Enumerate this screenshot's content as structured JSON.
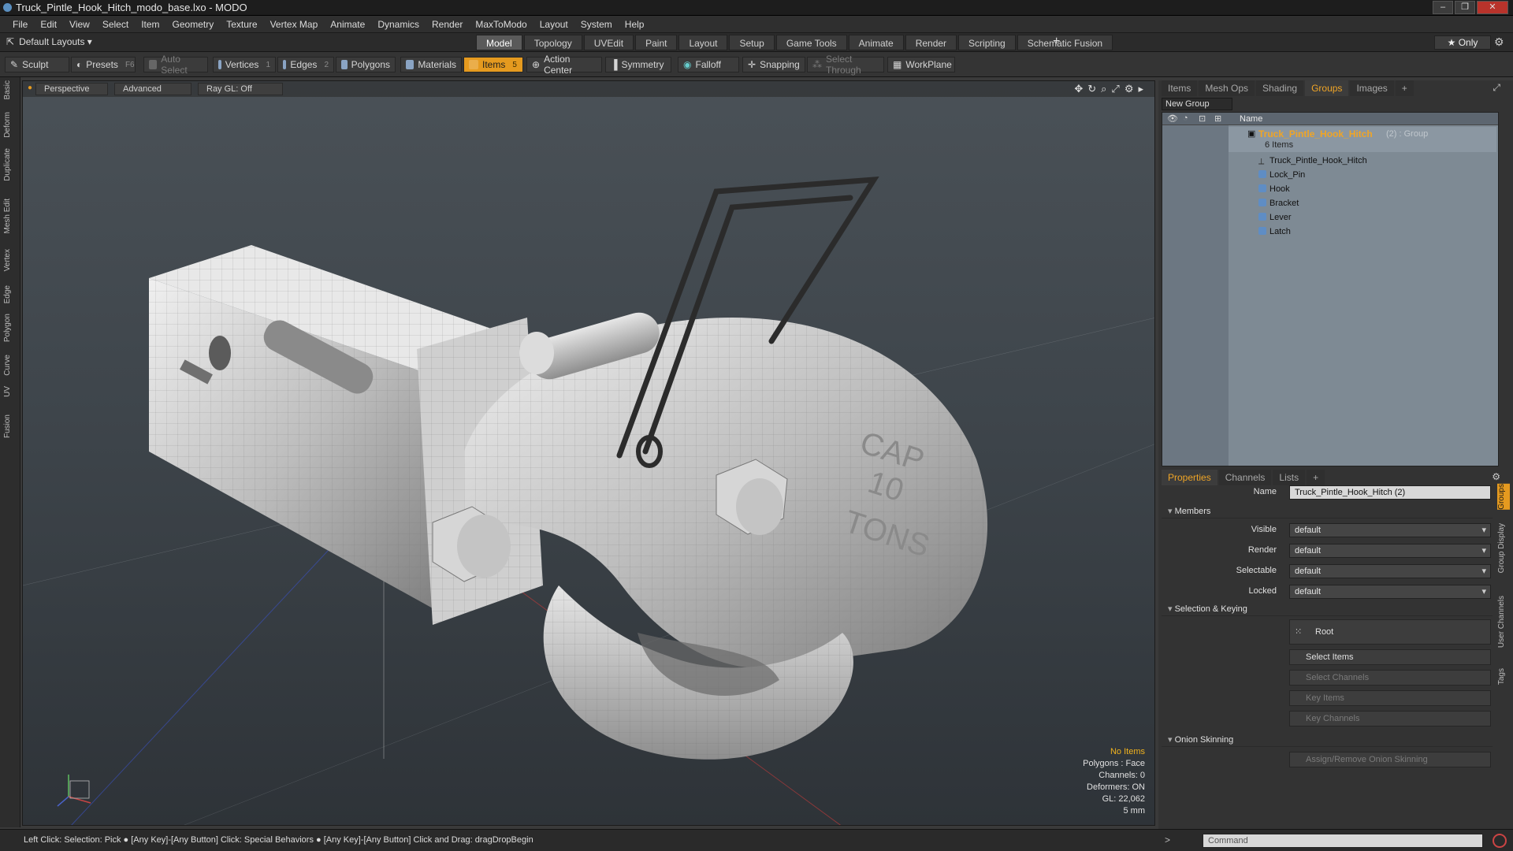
{
  "window": {
    "title": "Truck_Pintle_Hook_Hitch_modo_base.lxo - MODO"
  },
  "menu": [
    "File",
    "Edit",
    "View",
    "Select",
    "Item",
    "Geometry",
    "Texture",
    "Vertex Map",
    "Animate",
    "Dynamics",
    "Render",
    "MaxToModo",
    "Layout",
    "System",
    "Help"
  ],
  "layout_selector": "Default Layouts ▾",
  "layout_tabs": [
    {
      "label": "Model",
      "active": true
    },
    {
      "label": "Topology"
    },
    {
      "label": "UVEdit"
    },
    {
      "label": "Paint"
    },
    {
      "label": "Layout"
    },
    {
      "label": "Setup"
    },
    {
      "label": "Game Tools"
    },
    {
      "label": "Animate"
    },
    {
      "label": "Render"
    },
    {
      "label": "Scripting"
    },
    {
      "label": "Schematic Fusion"
    }
  ],
  "only_button": "★ Only",
  "toolbar": {
    "sculpt": "Sculpt",
    "presets": "Presets",
    "presets_key": "F6",
    "auto_select": "Auto Select",
    "vertices": "Vertices",
    "vertices_key": "1",
    "edges": "Edges",
    "edges_key": "2",
    "polygons": "Polygons",
    "materials": "Materials",
    "items": "Items",
    "items_key": "5",
    "action_center": "Action Center",
    "symmetry": "Symmetry",
    "falloff": "Falloff",
    "snapping": "Snapping",
    "select_through": "Select Through",
    "workplane": "WorkPlane"
  },
  "left_tabs": [
    "Basic",
    "Deform",
    "Duplicate",
    "Mesh Edit",
    "Vertex",
    "Edge",
    "Polygon",
    "Curve",
    "UV",
    "Fusion"
  ],
  "viewport": {
    "perspective": "Perspective",
    "advanced": "Advanced",
    "raygl": "Ray GL: Off",
    "hook_text": [
      "CAP",
      "10",
      "TONS"
    ],
    "info": {
      "no_items": "No Items",
      "polygons": "Polygons : Face",
      "channels": "Channels: 0",
      "deformers": "Deformers: ON",
      "gl": "GL: 22,062",
      "scale": "5 mm"
    }
  },
  "status_text": "Left Click: Selection: Pick ● [Any Key]-[Any Button] Click: Special Behaviors ● [Any Key]-[Any Button] Click and Drag: dragDropBegin",
  "top_panel_tabs": [
    {
      "label": "Items"
    },
    {
      "label": "Mesh Ops"
    },
    {
      "label": "Shading"
    },
    {
      "label": "Groups",
      "active": true
    },
    {
      "label": "Images"
    },
    {
      "label": "+"
    }
  ],
  "new_group": "New Group",
  "tree": {
    "header_name": "Name",
    "group": {
      "name": "Truck_Pintle_Hook_Hitch",
      "suffix": "(2) : Group",
      "count": "6 Items"
    },
    "children": [
      "Truck_Pintle_Hook_Hitch",
      "Lock_Pin",
      "Hook",
      "Bracket",
      "Lever",
      "Latch"
    ]
  },
  "bottom_panel_tabs": [
    {
      "label": "Properties",
      "active": true
    },
    {
      "label": "Channels"
    },
    {
      "label": "Lists"
    },
    {
      "label": "+"
    }
  ],
  "properties": {
    "name_label": "Name",
    "name_value": "Truck_Pintle_Hook_Hitch (2)",
    "members": "Members",
    "visible_label": "Visible",
    "visible_value": "default",
    "render_label": "Render",
    "render_value": "default",
    "selectable_label": "Selectable",
    "selectable_value": "default",
    "locked_label": "Locked",
    "locked_value": "default",
    "selection_keying": "Selection & Keying",
    "root": "Root",
    "select_items": "Select Items",
    "select_channels": "Select Channels",
    "key_items": "Key Items",
    "key_channels": "Key Channels",
    "onion_skinning": "Onion Skinning",
    "assign_onion": "Assign/Remove Onion Skinning"
  },
  "side_tabs": [
    "Groups",
    "Group Display",
    "User Channels",
    "Tags"
  ],
  "command_placeholder": "Command",
  "colors": {
    "accent": "#e59a1f",
    "group_name": "#f0a526",
    "info_warning": "#f0b21e"
  }
}
